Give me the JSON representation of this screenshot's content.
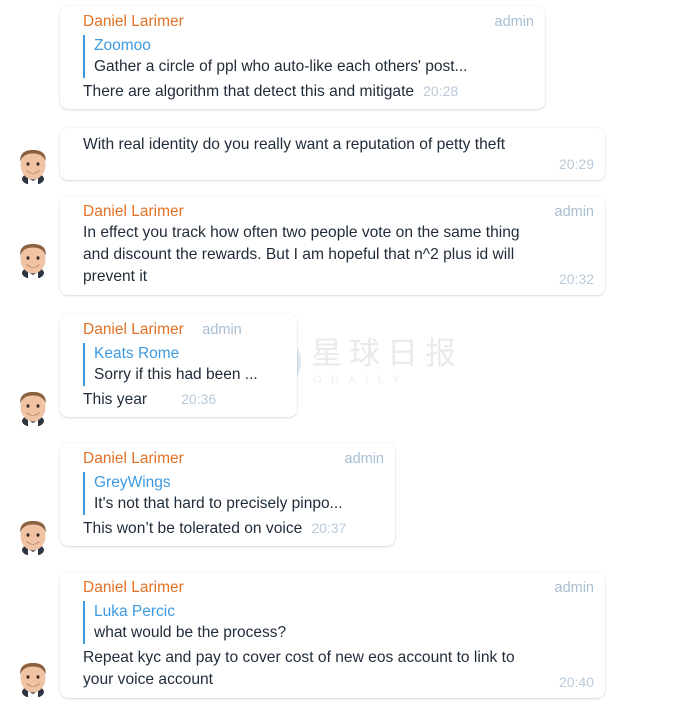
{
  "app": {
    "type": "chat-conversation",
    "background_color": "#ffffff",
    "sender_name_color": "#e17226",
    "reply_accent_color": "#3d9ae0",
    "timestamp_color": "#b9cadb",
    "admin_tag_color": "#a8bed2",
    "body_text_color": "#1f2b38"
  },
  "watermark": {
    "logo_letter": "D",
    "chinese_text": "星球日报",
    "english_text": "ODAILY",
    "logo_color": "#d9e6f2",
    "text_color": "#e9eaec"
  },
  "messages": [
    {
      "id": "msg-1",
      "sender": "Daniel Larimer",
      "admin_label": "admin",
      "reply": {
        "name": "Zoomoo",
        "text": "Gather a circle of ppl who auto-like each others' post..."
      },
      "text": "There are algorithm that detect this and mitigate",
      "time": "20:28",
      "has_avatar": false
    },
    {
      "id": "msg-2",
      "sender": "",
      "admin_label": "",
      "reply": null,
      "text": "With real identity do you really want a reputation of petty theft",
      "time": "20:29",
      "has_avatar": true
    },
    {
      "id": "msg-3",
      "sender": "Daniel Larimer",
      "admin_label": "admin",
      "reply": null,
      "text_line_1": "In effect you track how often two people vote on the same thing",
      "text_line_2": "and discount the rewards.  But I am hopeful that n^2 plus id will",
      "text_line_3": "prevent it",
      "time": "20:32",
      "has_avatar": true
    },
    {
      "id": "msg-4",
      "sender": "Daniel Larimer",
      "admin_label": "admin",
      "reply": {
        "name": "Keats Rome",
        "text": "Sorry if this had been ..."
      },
      "text": "This year",
      "time": "20:36",
      "has_avatar": true
    },
    {
      "id": "msg-5",
      "sender": "Daniel Larimer",
      "admin_label": "admin",
      "reply": {
        "name": "GreyWings",
        "text": "It's not that hard to precisely pinpo..."
      },
      "text": "This won’t be tolerated on voice",
      "time": "20:37",
      "has_avatar": true
    },
    {
      "id": "msg-6",
      "sender": "Daniel Larimer",
      "admin_label": "admin",
      "reply": {
        "name": "Luka Percic",
        "text": "what would be the process?"
      },
      "text_line_1": "Repeat kyc and pay to cover cost of new eos account to link to",
      "text_line_2": "your voice account",
      "time": "20:40",
      "has_avatar": true
    }
  ]
}
